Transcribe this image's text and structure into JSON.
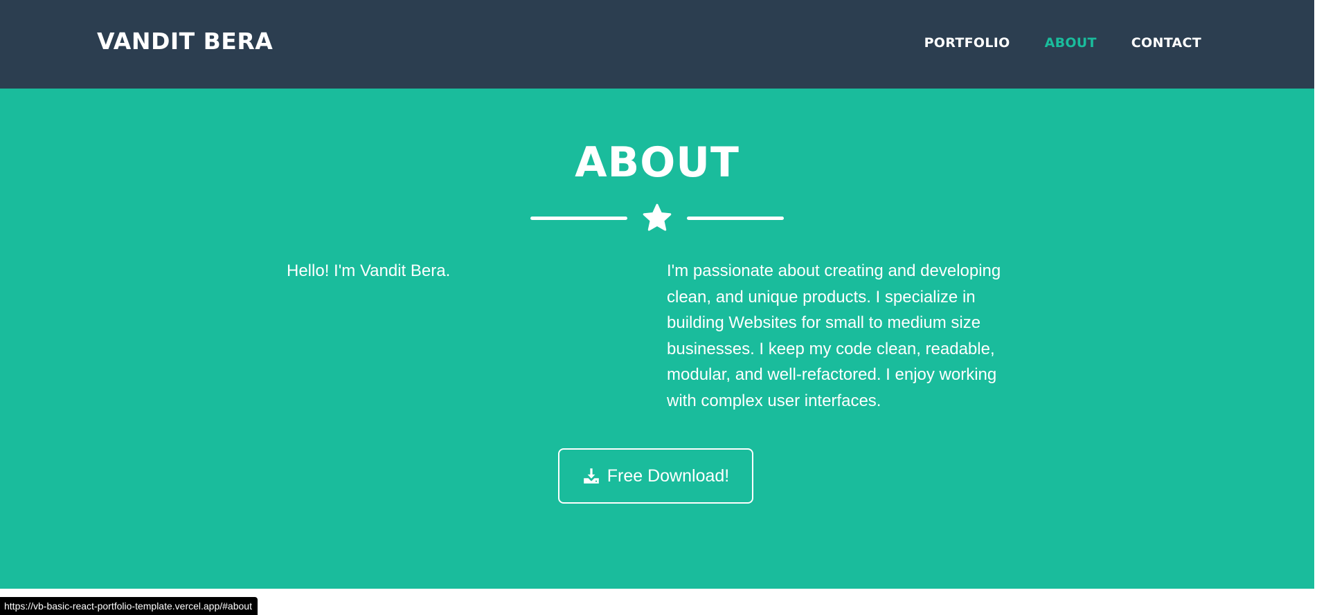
{
  "navbar": {
    "brand": "VANDIT BERA",
    "links": [
      {
        "label": "PORTFOLIO",
        "active": false
      },
      {
        "label": "ABOUT",
        "active": true
      },
      {
        "label": "CONTACT",
        "active": false
      }
    ]
  },
  "about": {
    "title": "ABOUT",
    "divider_icon": "star-icon",
    "left_text": "Hello! I'm Vandit Bera.",
    "right_text": "I'm passionate about creating and developing clean, and unique products. I specialize in building Websites for small to medium size businesses. I keep my code clean, readable, modular, and well-refactored. I enjoy working with complex user interfaces.",
    "download_button": {
      "icon": "download-icon",
      "label": "Free Download!"
    }
  },
  "status_bar": {
    "url": "https://vb-basic-react-portfolio-template.vercel.app/#about"
  },
  "colors": {
    "navbar_bg": "#2c3e50",
    "accent": "#1abc9c",
    "text": "#ffffff"
  }
}
